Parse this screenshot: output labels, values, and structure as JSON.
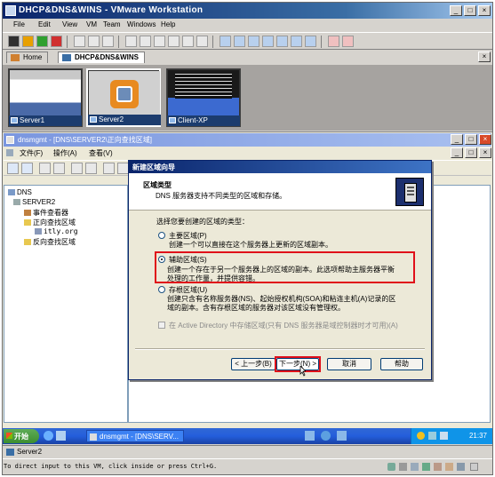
{
  "vmware": {
    "title": "DHCP&DNS&WINS - VMware Workstation",
    "menu": [
      "File",
      "Edit",
      "View",
      "VM",
      "Team",
      "Windows",
      "Help"
    ],
    "tabs": [
      {
        "label": "Home"
      },
      {
        "label": "DHCP&DNS&WINS"
      }
    ],
    "thumbnails": [
      "Server1",
      "Server2",
      "Client-XP"
    ],
    "status_tab": "Server2",
    "status_message": "To direct input to this VM, click inside or press Ctrl+G."
  },
  "dnsmgmt": {
    "title": "dnsmgmt - [DNS\\SERVER2\\正向查找区域]",
    "menu": [
      "文件(F)",
      "操作(A)",
      "查看(V)"
    ],
    "tree": [
      {
        "label": "DNS"
      },
      {
        "label": "SERVER2"
      },
      {
        "label": "事件查看器"
      },
      {
        "label": "正向查找区域"
      },
      {
        "label": "itly.org"
      },
      {
        "label": "反向查找区域"
      }
    ]
  },
  "wizard": {
    "title": "新建区域向导",
    "header_title": "区域类型",
    "header_subtitle": "DNS 服务器支持不同类型的区域和存储。",
    "prompt": "选择您要创建的区域的类型：",
    "options": [
      {
        "label": "主要区域(P)",
        "desc": [
          "创建一个可以直接在这个服务器上更新的区域副本。"
        ],
        "selected": false
      },
      {
        "label": "辅助区域(S)",
        "desc": [
          "创建一个存在于另一个服务器上的区域的副本。此选项帮助主服务器平衡",
          "处理的工作量，并提供容错。"
        ],
        "selected": true
      },
      {
        "label": "存根区域(U)",
        "desc": [
          "创建只含有名称服务器(NS)、起始授权机构(SOA)和粘连主机(A)记录的区",
          "域的副本。含有存根区域的服务器对该区域没有管理权。"
        ],
        "selected": false
      }
    ],
    "ad_checkbox": "在 Active Directory 中存储区域(只有 DNS 服务器是域控制器时才可用)(A)",
    "buttons": {
      "back": "< 上一步(B)",
      "next": "下一步(N) >",
      "cancel": "取消",
      "help": "帮助"
    }
  },
  "taskbar": {
    "start": "开始",
    "task": "dnsmgmt - [DNS\\SERV...",
    "clock": "21:37"
  },
  "colors": {
    "highlight": "#e0101a",
    "title_blue": "#0a246a",
    "taskbar_blue": "#245edb"
  }
}
